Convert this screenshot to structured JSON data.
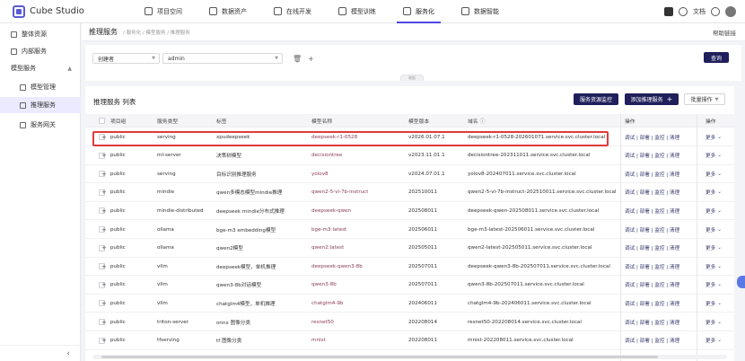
{
  "app": {
    "name": "Cube Studio"
  },
  "nav": [
    {
      "label": "项目空间"
    },
    {
      "label": "数据资产"
    },
    {
      "label": "在线开发"
    },
    {
      "label": "模型训练"
    },
    {
      "label": "服务化"
    },
    {
      "label": "数据智能"
    }
  ],
  "top_right": {
    "user": "文档"
  },
  "sidebar": {
    "items": [
      {
        "label": "整体资源"
      },
      {
        "label": "内部服务"
      },
      {
        "label": "模型服务"
      },
      {
        "label": "模型管理"
      },
      {
        "label": "推理服务"
      },
      {
        "label": "服务网关"
      }
    ]
  },
  "header": {
    "title": "推理服务",
    "breadcrumb": "/ 服务化 / 模型服务 / 推理服务",
    "help": "帮助链接"
  },
  "filters": {
    "field": "创建者",
    "value": "admin",
    "query": "查询",
    "fold": "收起"
  },
  "list": {
    "title": "推理服务 列表",
    "monitor_btn": "服务资源监控",
    "add_btn": "添加推理服务",
    "batch_btn": "批量操作",
    "columns": [
      "项目组",
      "服务类型",
      "标签",
      "模型名称",
      "模型版本",
      "域名",
      "操作",
      "操作"
    ],
    "rows": [
      {
        "group": "public",
        "type": "serving",
        "label": "xpudeepseek",
        "model": "deepseek-r1-0528",
        "version": "v2026.01.07.1",
        "domain": "deepseek-r1-0528-202601071.service.svc.cluster.local",
        "ops": "调试 | 部署 | 监控 | 清理",
        "more": "更多"
      },
      {
        "group": "public",
        "type": "ml-server",
        "label": "决策树模型",
        "model": "decisiontree",
        "version": "v2023.11.01.1",
        "domain": "decisiontree-202311011.service.svc.cluster.local",
        "ops": "调试 | 部署 | 监控 | 清理",
        "more": "更多"
      },
      {
        "group": "public",
        "type": "serving",
        "label": "目标识别推理服务",
        "model": "yolov8",
        "version": "v2024.07.01.1",
        "domain": "yolov8-202407011.service.svc.cluster.local",
        "ops": "调试 | 部署 | 监控 | 清理",
        "more": "更多"
      },
      {
        "group": "public",
        "type": "mindie",
        "label": "qwen多模态模型mindie推理",
        "model": "qwen2-5-vl-7b-instruct",
        "version": "202510011",
        "domain": "qwen2-5-vl-7b-instruct-202510011.service.svc.cluster.local",
        "ops": "调试 | 部署 | 监控 | 清理",
        "more": "更多"
      },
      {
        "group": "public",
        "type": "mindie-distributed",
        "label": "deepseek mindie分布式推理",
        "model": "deepseek-qwen",
        "version": "202508011",
        "domain": "deepseek-qwen-202508011.service.svc.cluster.local",
        "ops": "调试 | 部署 | 监控 | 清理",
        "more": "更多"
      },
      {
        "group": "public",
        "type": "ollama",
        "label": "bge-m3 embedding模型",
        "model": "bge-m3:latest",
        "version": "202506011",
        "domain": "bge-m3-latest-202506011.service.svc.cluster.local",
        "ops": "调试 | 部署 | 监控 | 清理",
        "more": "更多"
      },
      {
        "group": "public",
        "type": "ollama",
        "label": "qwen2模型",
        "model": "qwen2:latest",
        "version": "202505011",
        "domain": "qwen2-latest-202505011.service.svc.cluster.local",
        "ops": "调试 | 部署 | 监控 | 清理",
        "more": "更多"
      },
      {
        "group": "public",
        "type": "vllm",
        "label": "deepseek模型，单机推理",
        "model": "deepseek-qwen3-8b",
        "version": "202507011",
        "domain": "deepseek-qwen3-8b-202507011.service.svc.cluster.local",
        "ops": "调试 | 部署 | 监控 | 清理",
        "more": "更多"
      },
      {
        "group": "public",
        "type": "vllm",
        "label": "qwen3-8b对话模型",
        "model": "qwen3-8b",
        "version": "202507011",
        "domain": "qwen3-8b-202507011.service.svc.cluster.local",
        "ops": "调试 | 部署 | 监控 | 清理",
        "more": "更多"
      },
      {
        "group": "public",
        "type": "vllm",
        "label": "chatglm4模型，单机推理",
        "model": "chatglm4-9b",
        "version": "202406011",
        "domain": "chatglm4-9b-202406011.service.svc.cluster.local",
        "ops": "调试 | 部署 | 监控 | 清理",
        "more": "更多"
      },
      {
        "group": "public",
        "type": "triton-server",
        "label": "onnx 图像分类",
        "model": "resnet50",
        "version": "202208014",
        "domain": "resnet50-202208014.service.svc.cluster.local",
        "ops": "调试 | 部署 | 监控 | 清理",
        "more": "更多"
      },
      {
        "group": "public",
        "type": "tfserving",
        "label": "tf 图像分类",
        "model": "mnist",
        "version": "202208011",
        "domain": "mnist-202208011.service.svc.cluster.local",
        "ops": "调试 | 部署 | 监控 | 清理",
        "more": "更多"
      }
    ]
  }
}
